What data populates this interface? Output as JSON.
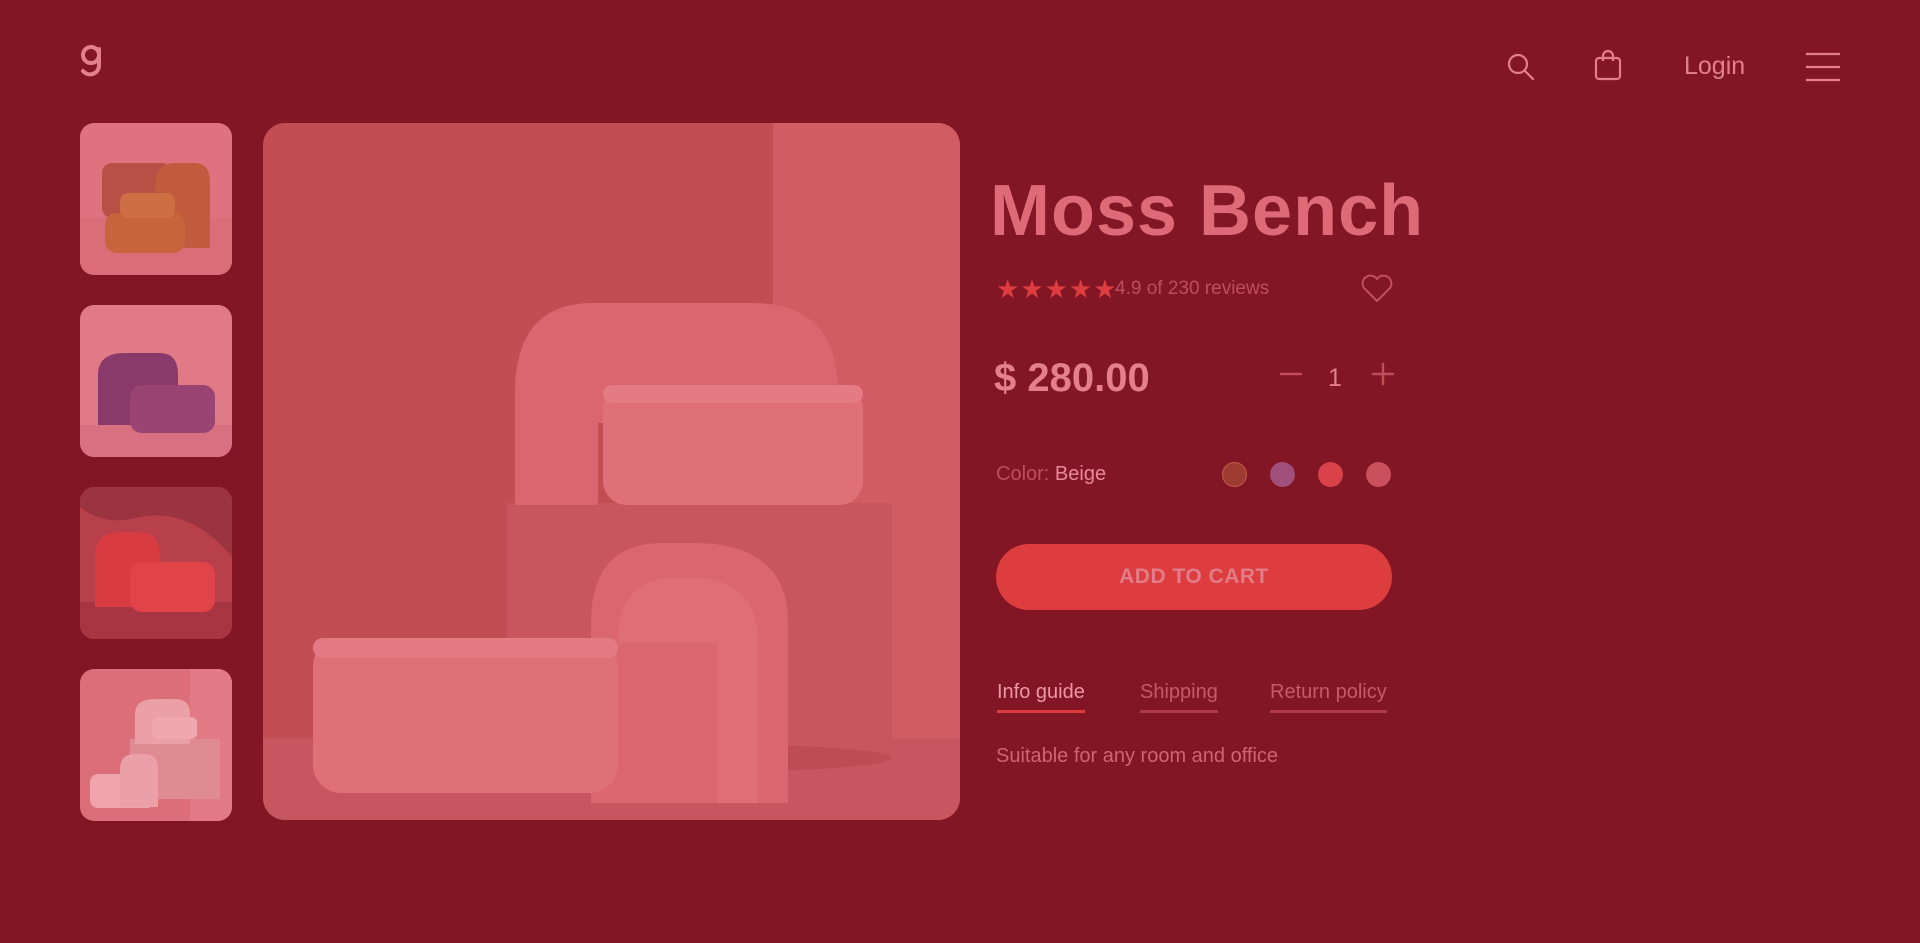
{
  "header": {
    "logo_icon": "g-logo-icon",
    "search_icon": "search-icon",
    "cart_icon": "shopping-bag-icon",
    "login_label": "Login",
    "menu_icon": "hamburger-menu-icon"
  },
  "gallery": {
    "thumbnails": [
      {
        "name": "thumbnail-orange-bench",
        "color": "#c8643c"
      },
      {
        "name": "thumbnail-purple-bench",
        "color": "#8a3a6a"
      },
      {
        "name": "thumbnail-red-bench",
        "color": "#d83c40"
      },
      {
        "name": "thumbnail-pink-bench",
        "color": "#e08890"
      }
    ]
  },
  "product": {
    "title": "Moss Bench",
    "rating_stars": 5,
    "rating_text": "4.9 of 230 reviews",
    "price": "$ 280.00",
    "quantity": "1",
    "color_label": "Color:",
    "color_value": "Beige",
    "swatches": [
      "#9e3b30",
      "#a04f7a",
      "#d84248",
      "#c9505c"
    ],
    "add_to_cart_label": "ADD TO CART",
    "tabs": [
      {
        "label": "Info guide",
        "active": true
      },
      {
        "label": "Shipping",
        "active": false
      },
      {
        "label": "Return policy",
        "active": false
      }
    ],
    "description": "Suitable for any room and office"
  },
  "colors": {
    "background": "#821624",
    "accent": "#dd3d3f",
    "text": "#e0707e"
  }
}
